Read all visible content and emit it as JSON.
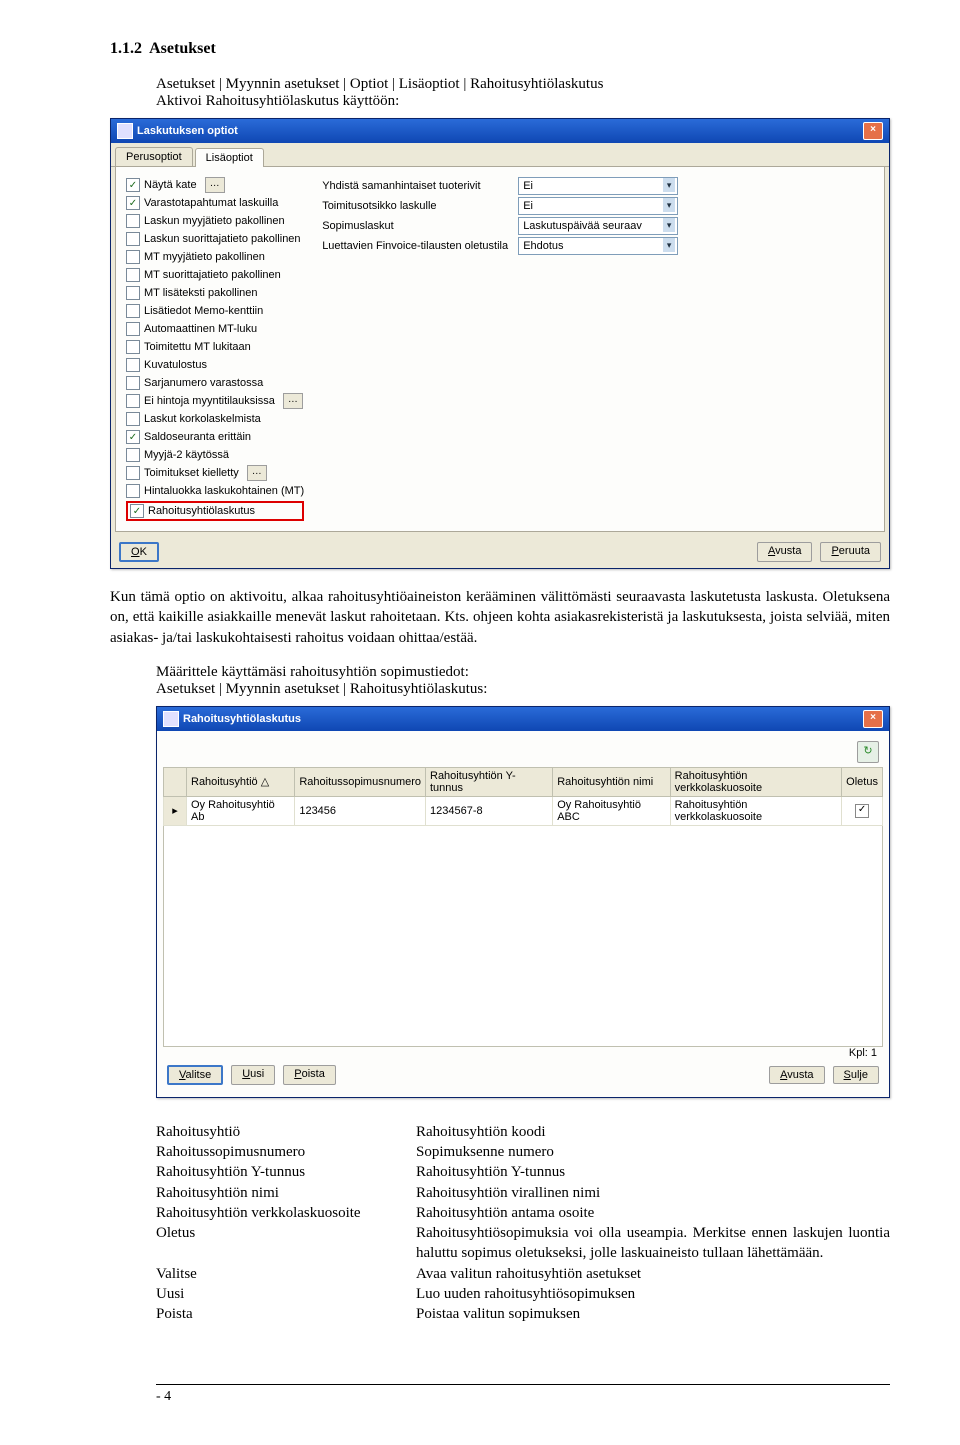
{
  "section": {
    "num": "1.1.2",
    "title": "Asetukset"
  },
  "intro": {
    "line1": "Asetukset | Myynnin asetukset | Optiot | Lisäoptiot | Rahoitusyhtiölaskutus",
    "line2": "Aktivoi Rahoitusyhtiölaskutus käyttöön:"
  },
  "win1": {
    "title": "Laskutuksen optiot",
    "tabs": [
      "Perusoptiot",
      "Lisäoptiot"
    ],
    "left_checks": [
      {
        "label": "Näytä kate",
        "on": true,
        "ell": true
      },
      {
        "label": "Varastotapahtumat laskuilla",
        "on": true
      },
      {
        "label": "Laskun myyjätieto pakollinen",
        "on": false
      },
      {
        "label": "Laskun suorittajatieto pakollinen",
        "on": false
      },
      {
        "label": "MT myyjätieto pakollinen",
        "on": false
      },
      {
        "label": "MT suorittajatieto pakollinen",
        "on": false
      },
      {
        "label": "MT lisäteksti pakollinen",
        "on": false
      },
      {
        "label": "Lisätiedot Memo-kenttiin",
        "on": false
      },
      {
        "label": "Automaattinen MT-luku",
        "on": false
      },
      {
        "label": "Toimitettu MT lukitaan",
        "on": false
      },
      {
        "label": "Kuvatulostus",
        "on": false
      },
      {
        "label": "Sarjanumero varastossa",
        "on": false
      },
      {
        "label": "Ei hintoja myyntitilauksissa",
        "on": false,
        "ell": true
      },
      {
        "label": "Laskut korkolaskelmista",
        "on": false
      },
      {
        "label": "Saldoseuranta erittäin",
        "on": true
      },
      {
        "label": "Myyjä-2 käytössä",
        "on": false
      },
      {
        "label": "Toimitukset kielletty",
        "on": false,
        "ell": true
      },
      {
        "label": "Hintaluokka laskukohtainen (MT)",
        "on": false
      },
      {
        "label": "Rahoitusyhtiölaskutus",
        "on": true,
        "hl": true
      }
    ],
    "right_rows": [
      {
        "label": "Yhdistä samanhintaiset tuoterivit",
        "value": "Ei"
      },
      {
        "label": "Toimitusotsikko laskulle",
        "value": "Ei"
      },
      {
        "label": "Sopimuslaskut",
        "value": "Laskutuspäivää seuraav"
      },
      {
        "label": "Luettavien Finvoice-tilausten oletustila",
        "value": "Ehdotus"
      }
    ],
    "buttons": {
      "ok": "OK",
      "help": "Avusta",
      "cancel": "Peruuta"
    }
  },
  "mid": {
    "p1": "Kun tämä optio on aktivoitu, alkaa rahoitusyhtiöaineiston kerääminen välittömästi seuraavasta laskutetusta laskusta. Oletuksena on, että kaikille asiakkaille menevät laskut rahoitetaan. Kts. ohjeen kohta asiakasrekisteristä ja laskutuksesta, joista selviää, miten asiakas- ja/tai laskukohtaisesti rahoitus voidaan ohittaa/estää.",
    "p2": "Määrittele käyttämäsi rahoitusyhtiön sopimustiedot:",
    "p3": "Asetukset | Myynnin asetukset | Rahoitusyhtiölaskutus:"
  },
  "win2": {
    "title": "Rahoitusyhtiölaskutus",
    "cols": [
      "Rahoitusyhtiö △",
      "Rahoitussopimusnumero",
      "Rahoitusyhtiön Y-tunnus",
      "Rahoitusyhtiön nimi",
      "Rahoitusyhtiön verkkolaskuosoite",
      "Oletus"
    ],
    "row": {
      "company": "Oy Rahoitusyhtiö Ab",
      "contract": "123456",
      "ytunnus": "1234567-8",
      "name": "Oy Rahoitusyhtiö ABC",
      "einv": "Rahoitusyhtiön verkkolaskuosoite",
      "default_on": true
    },
    "kpl": "Kpl: 1",
    "buttons": {
      "valitse": "Valitse",
      "uusi": "Uusi",
      "poista": "Poista",
      "avusta": "Avusta",
      "sulje": "Sulje"
    }
  },
  "defs": [
    {
      "term": "Rahoitusyhtiö",
      "desc": "Rahoitusyhtiön koodi"
    },
    {
      "term": "Rahoitussopimusnumero",
      "desc": "Sopimuksenne numero"
    },
    {
      "term": "Rahoitusyhtiön Y-tunnus",
      "desc": "Rahoitusyhtiön Y-tunnus"
    },
    {
      "term": "Rahoitusyhtiön nimi",
      "desc": "Rahoitusyhtiön virallinen nimi"
    },
    {
      "term": "Rahoitusyhtiön verkkolaskuosoite",
      "desc": "Rahoitusyhtiön antama osoite"
    },
    {
      "term": "Oletus",
      "desc": "Rahoitusyhtiösopimuksia voi olla useampia. Merkitse ennen laskujen luontia haluttu sopimus oletukseksi, jolle laskuaineisto tullaan lähettämään."
    },
    {
      "term": "Valitse",
      "desc": "Avaa valitun rahoitusyhtiön asetukset"
    },
    {
      "term": "Uusi",
      "desc": "Luo uuden rahoitusyhtiösopimuksen"
    },
    {
      "term": "Poista",
      "desc": "Poistaa valitun sopimuksen"
    }
  ],
  "footer": "- 4"
}
